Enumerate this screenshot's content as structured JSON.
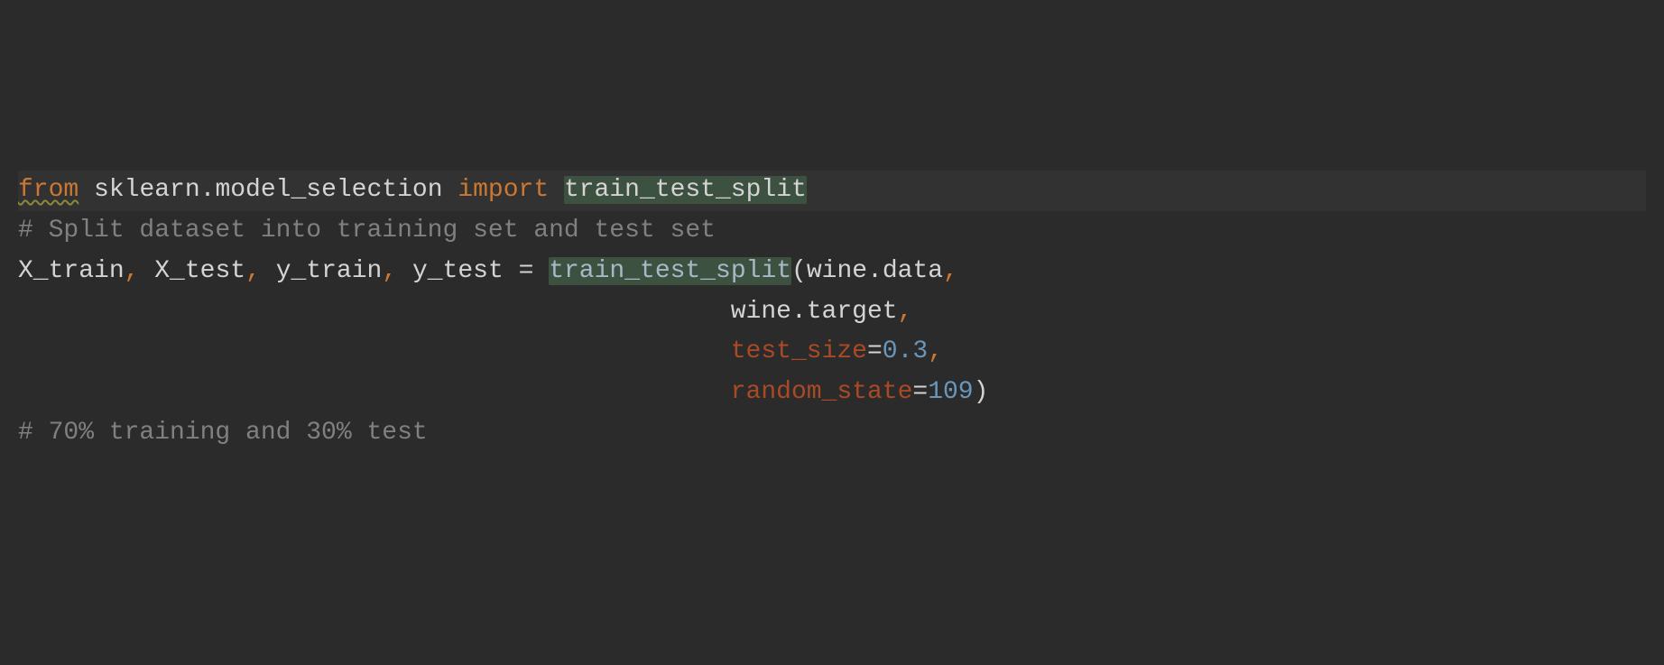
{
  "code": {
    "line1": {
      "from": "from",
      "module": "sklearn.model_selection",
      "import": "import",
      "symbol": "train_test_split"
    },
    "line2": {
      "comment": "# Split dataset into training set and test set"
    },
    "line3": {
      "v1": "X_train",
      "c1": ",",
      "sp1": " ",
      "v2": "X_test",
      "c2": ",",
      "sp2": " ",
      "v3": "y_train",
      "c3": ",",
      "sp3": " ",
      "v4": "y_test",
      "eq": " = ",
      "fn": "train_test_split",
      "open": "(",
      "arg1": "wine.data",
      "c4": ","
    },
    "line4": {
      "indent": "                                               ",
      "arg": "wine.target",
      "c": ","
    },
    "line5": {
      "indent": "                                               ",
      "param": "test_size",
      "eq": "=",
      "val": "0.3",
      "c": ","
    },
    "line6": {
      "indent": "                                               ",
      "param": "random_state",
      "eq": "=",
      "val": "109",
      "close": ")"
    },
    "line7": {
      "comment": "# 70% training and 30% test"
    }
  }
}
